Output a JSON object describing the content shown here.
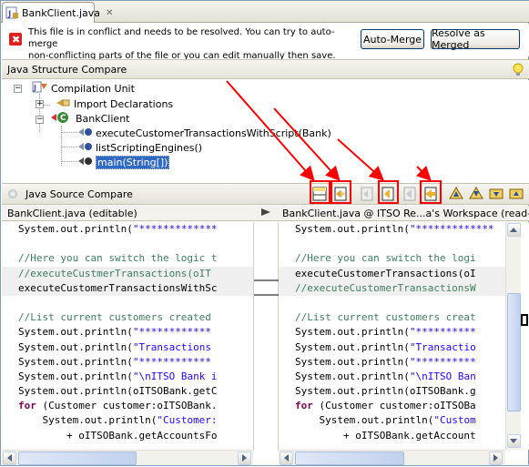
{
  "tab": {
    "title": "BankClient.java"
  },
  "conflict": {
    "line1": "This file is in conflict and needs to be resolved. You can try to auto-merge",
    "line2": "non-conflicting parts of the file or you can edit manually then save.",
    "auto_merge": "Auto-Merge",
    "resolve": "Resolve as Merged"
  },
  "structure": {
    "title": "Java Structure Compare",
    "nodes": [
      "Compilation Unit",
      "Import Declarations",
      "BankClient",
      "executeCustomerTransactionsWithScript(Bank)",
      "listScriptingEngines()",
      "main(String[])"
    ]
  },
  "source": {
    "title": "Java Source Compare"
  },
  "left": {
    "label": "BankClient.java  (editable)",
    "lines": [
      "System.out.println(\"*************",
      "",
      "//Here you can switch the logic t",
      "//executeCustmerTransactions(oIT",
      "executeCustomerTransactionsWithSc",
      "",
      "//List current customers created",
      "System.out.println(\"************",
      "System.out.println(\"Transactions",
      "System.out.println(\"************",
      "System.out.println(\"\\nITSO Bank i",
      "System.out.println(oITSOBank.getC",
      "for (Customer customer:oITSOBank.",
      "    System.out.println(\"Customer:",
      "        + oITSOBank.getAccountsFo"
    ]
  },
  "right": {
    "label": "BankClient.java @ ITSO Re...a's Workspace (read-only)",
    "lines": [
      "System.out.println(\"*************",
      "",
      "//Here you can switch the logi",
      "executeCustomerTransactions(oI",
      "//executeCustomerTransactionsW",
      "",
      "//List current customers creat",
      "System.out.println(\"**********",
      "System.out.println(\"Transactio",
      "System.out.println(\"**********",
      "System.out.println(\"\\nITSO Ban",
      "System.out.println(oITSOBank.g",
      "for (Customer customer:oITSOBa",
      "    System.out.println(\"Custom",
      "        + oITSOBank.getAccount"
    ]
  }
}
